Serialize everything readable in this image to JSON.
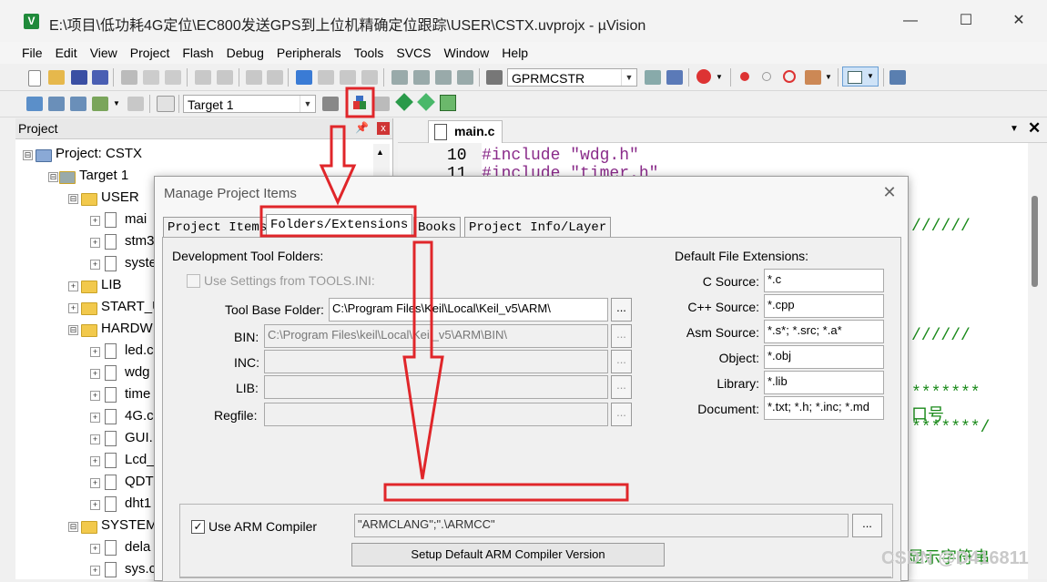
{
  "window": {
    "title": "E:\\项目\\低功耗4G定位\\EC800发送GPS到上位机精确定位跟踪\\USER\\CSTX.uvprojx - µVision",
    "app_icon_letter": "V",
    "minimize": "—",
    "maximize": "☐",
    "close": "✕"
  },
  "menu": [
    "File",
    "Edit",
    "View",
    "Project",
    "Flash",
    "Debug",
    "Peripherals",
    "Tools",
    "SVCS",
    "Window",
    "Help"
  ],
  "toolbar1": {
    "find_value": "GPRMCSTR"
  },
  "toolbar2": {
    "target_value": "Target 1"
  },
  "project_panel": {
    "title": "Project",
    "pin": "📌",
    "close": "x",
    "tree": [
      {
        "label": "Project: CSTX",
        "kind": "project",
        "exp": "⊟"
      },
      {
        "label": "Target 1",
        "kind": "target",
        "exp": "⊟"
      },
      {
        "label": "USER",
        "kind": "folder",
        "exp": "⊟"
      },
      {
        "label": "mai",
        "kind": "file",
        "exp": "+"
      },
      {
        "label": "stm3",
        "kind": "file",
        "exp": "+"
      },
      {
        "label": "syste",
        "kind": "file",
        "exp": "+"
      },
      {
        "label": "LIB",
        "kind": "folder",
        "exp": "+"
      },
      {
        "label": "START_U",
        "kind": "folder",
        "exp": "+"
      },
      {
        "label": "HARDW",
        "kind": "folder",
        "exp": "⊟"
      },
      {
        "label": "led.c",
        "kind": "file",
        "exp": "+"
      },
      {
        "label": "wdg",
        "kind": "file",
        "exp": "+"
      },
      {
        "label": "time",
        "kind": "file",
        "exp": "+"
      },
      {
        "label": "4G.c",
        "kind": "file",
        "exp": "+"
      },
      {
        "label": "GUI.",
        "kind": "file",
        "exp": "+"
      },
      {
        "label": "Lcd_",
        "kind": "file",
        "exp": "+"
      },
      {
        "label": "QDT",
        "kind": "file",
        "exp": "+"
      },
      {
        "label": "dht1",
        "kind": "file",
        "exp": "+"
      },
      {
        "label": "SYSTEM",
        "kind": "folder",
        "exp": "⊟"
      },
      {
        "label": "dela",
        "kind": "file",
        "exp": "+"
      },
      {
        "label": "sys.c",
        "kind": "file",
        "exp": "+"
      }
    ]
  },
  "editor": {
    "tab_label": "main.c",
    "lines": [
      {
        "num": "10",
        "prefix": "#include",
        "str": " \"wdg.h\""
      },
      {
        "num": "11",
        "prefix": "#include",
        "str": " \"timer.h\""
      }
    ],
    "fragments": [
      "//////",
      "//////",
      "*******",
      "口号",
      "*******/",
      "显示字符串"
    ]
  },
  "dialog": {
    "title": "Manage Project Items",
    "close": "✕",
    "tabs": [
      "Project Items",
      "Folders/Extensions",
      "Books",
      "Project Info/Layer"
    ],
    "dev_tool_folders_label": "Development Tool Folders:",
    "use_settings_label": "Use Settings from TOOLS.INI:",
    "tool_base_label": "Tool Base Folder:",
    "tool_base_value": "C:\\Program Files\\Keil\\Local\\Keil_v5\\ARM\\",
    "bin_label": "BIN:",
    "bin_value": "C:\\Program Files\\keil\\Local\\Keil_v5\\ARM\\BIN\\",
    "inc_label": "INC:",
    "lib_label": "LIB:",
    "regfile_label": "Regfile:",
    "browse": "...",
    "default_ext_label": "Default File Extensions:",
    "extensions": [
      {
        "label": "C Source:",
        "value": "*.c"
      },
      {
        "label": "C++ Source:",
        "value": "*.cpp"
      },
      {
        "label": "Asm Source:",
        "value": "*.s*; *.src; *.a*"
      },
      {
        "label": "Object:",
        "value": "*.obj"
      },
      {
        "label": "Library:",
        "value": "*.lib"
      },
      {
        "label": "Document:",
        "value": "*.txt; *.h; *.inc; *.md"
      }
    ],
    "use_arm_compiler_label": "Use ARM Compiler",
    "compiler_value": "\"ARMCLANG\";\".\\ARMCC\"",
    "setup_button": "Setup Default ARM Compiler Version",
    "check_mark": "✓"
  },
  "watermark": "CSDN @D416811"
}
